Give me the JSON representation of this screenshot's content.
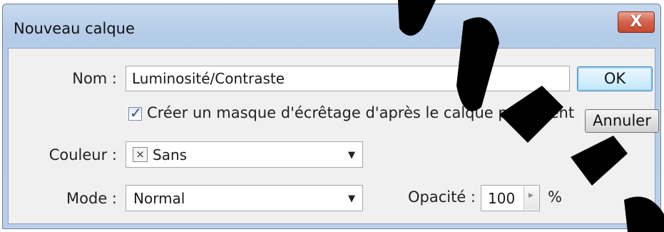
{
  "dialog": {
    "title": "Nouveau calque",
    "close_glyph": "X",
    "name_label": "Nom :",
    "name_value": "Luminosité/Contraste",
    "ok_label": "OK",
    "clip_checkbox_label": "Créer un masque d'écrêtage d'après le calque précédent",
    "clip_checked": true,
    "cancel_label": "Annuler",
    "color_label": "Couleur :",
    "color_value": "Sans",
    "color_swatch_glyph": "×",
    "mode_label": "Mode :",
    "mode_value": "Normal",
    "opacity_label": "Opacité :",
    "opacity_value": "100",
    "opacity_unit": "%"
  },
  "icons": {
    "close": "close-icon",
    "dropdown": "chevron-down-icon",
    "check": "checkmark-icon",
    "no_color": "x-swatch-icon",
    "spinner": "triangle-right-icon"
  },
  "colors": {
    "title_bar": "#b9cfe9",
    "close_button": "#d4614a",
    "panel": "#f0f0f0",
    "primary_button_border": "#3c7fb1"
  }
}
